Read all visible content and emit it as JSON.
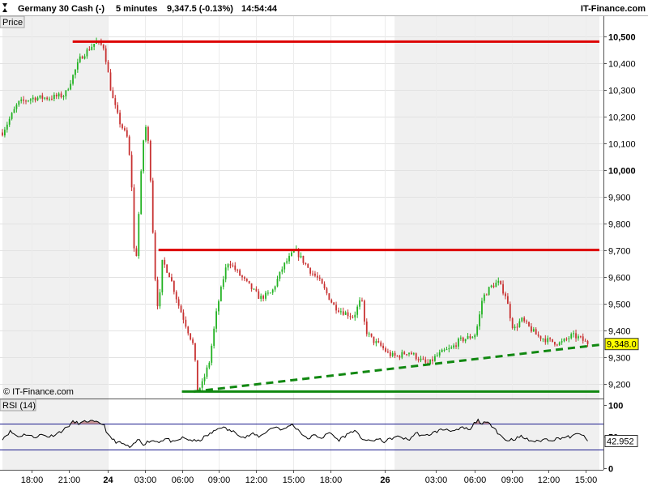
{
  "header": {
    "instrument": "Germany 30 Cash (-)",
    "interval": "5 minutes",
    "quote": "9,347.5 (-0.13%)",
    "time": "14:54:44",
    "brand": "IT-Finance.com"
  },
  "price_panel": {
    "label": "Price",
    "copyright": "© IT-Finance.com",
    "last_price_badge": "9,348.0"
  },
  "rsi_panel": {
    "label": "RSI (14)",
    "last_value_badge": "42.952"
  },
  "colors": {
    "up_candle": "#22b222",
    "down_candle": "#c83232",
    "resistance": "#dd0000",
    "support": "#118811",
    "rsi_line": "#000000",
    "rsi_band": "#1a1a8c",
    "rsi_overbought_fill": "#c89696",
    "session_shade": "#f0f0f0"
  },
  "chart_data": [
    {
      "type": "candlestick",
      "yticks": [
        "10,500",
        "10,400",
        "10,300",
        "10,200",
        "10,100",
        "10,000",
        "9,900",
        "9,800",
        "9,700",
        "9,600",
        "9,500",
        "9,400",
        "9,300",
        "9,200"
      ],
      "ytick_values": [
        10500,
        10400,
        10300,
        10200,
        10100,
        10000,
        9900,
        9800,
        9700,
        9600,
        9500,
        9400,
        9300,
        9200
      ],
      "ylim": [
        9150,
        10545
      ],
      "xlim": [
        0,
        153
      ],
      "xticks": [
        {
          "label": "18:00",
          "t": 7.5,
          "bold": false
        },
        {
          "label": "21:00",
          "t": 17,
          "bold": false
        },
        {
          "label": "24",
          "t": 27,
          "bold": true
        },
        {
          "label": "03:00",
          "t": 36.5,
          "bold": false
        },
        {
          "label": "06:00",
          "t": 46,
          "bold": false
        },
        {
          "label": "09:00",
          "t": 55.5,
          "bold": false
        },
        {
          "label": "12:00",
          "t": 65,
          "bold": false
        },
        {
          "label": "15:00",
          "t": 74.5,
          "bold": false
        },
        {
          "label": "18:00",
          "t": 84,
          "bold": false
        },
        {
          "label": "26",
          "t": 98,
          "bold": true
        },
        {
          "label": "03:00",
          "t": 111,
          "bold": false
        },
        {
          "label": "06:00",
          "t": 121,
          "bold": false
        },
        {
          "label": "09:00",
          "t": 130.5,
          "bold": false
        },
        {
          "label": "12:00",
          "t": 140,
          "bold": false
        },
        {
          "label": "15:00",
          "t": 149.5,
          "bold": false
        }
      ],
      "shaded_sessions": [
        [
          0,
          27
        ],
        [
          100.5,
          153
        ]
      ],
      "anchors": [
        [
          0,
          10140
        ],
        [
          4,
          10250
        ],
        [
          8,
          10270
        ],
        [
          12,
          10270
        ],
        [
          16,
          10280
        ],
        [
          20,
          10420
        ],
        [
          24,
          10480
        ],
        [
          26,
          10460
        ],
        [
          28,
          10280
        ],
        [
          30,
          10180
        ],
        [
          32,
          10120
        ],
        [
          33,
          9990
        ],
        [
          34,
          9600
        ],
        [
          35,
          9850
        ],
        [
          36,
          10100
        ],
        [
          37,
          10180
        ],
        [
          38,
          9960
        ],
        [
          39,
          9620
        ],
        [
          40,
          9460
        ],
        [
          41,
          9660
        ],
        [
          43,
          9600
        ],
        [
          45,
          9500
        ],
        [
          47,
          9420
        ],
        [
          49,
          9340
        ],
        [
          50,
          9180
        ],
        [
          51,
          9190
        ],
        [
          53,
          9280
        ],
        [
          55,
          9480
        ],
        [
          57,
          9620
        ],
        [
          58,
          9660
        ],
        [
          60,
          9620
        ],
        [
          63,
          9570
        ],
        [
          66,
          9520
        ],
        [
          69,
          9540
        ],
        [
          72,
          9640
        ],
        [
          75,
          9700
        ],
        [
          77,
          9660
        ],
        [
          79,
          9620
        ],
        [
          81,
          9590
        ],
        [
          83,
          9540
        ],
        [
          85,
          9490
        ],
        [
          87,
          9470
        ],
        [
          90,
          9450
        ],
        [
          92,
          9520
        ],
        [
          93,
          9400
        ],
        [
          95,
          9360
        ],
        [
          97,
          9340
        ],
        [
          99,
          9310
        ],
        [
          101,
          9300
        ],
        [
          104,
          9320
        ],
        [
          107,
          9290
        ],
        [
          109,
          9270
        ],
        [
          111,
          9300
        ],
        [
          113,
          9320
        ],
        [
          115,
          9330
        ],
        [
          117,
          9360
        ],
        [
          119,
          9370
        ],
        [
          121,
          9380
        ],
        [
          122,
          9430
        ],
        [
          123,
          9520
        ],
        [
          125,
          9560
        ],
        [
          127,
          9580
        ],
        [
          129,
          9530
        ],
        [
          130,
          9460
        ],
        [
          131,
          9400
        ],
        [
          133,
          9440
        ],
        [
          135,
          9410
        ],
        [
          137,
          9380
        ],
        [
          140,
          9360
        ],
        [
          143,
          9350
        ],
        [
          146,
          9380
        ],
        [
          148,
          9370
        ],
        [
          150,
          9348
        ]
      ],
      "last_price": 9348.0,
      "lines": [
        {
          "name": "upper-resistance",
          "kind": "horizontal",
          "value": 10480,
          "t_start": 18,
          "t_end": 153,
          "style": "solid",
          "color": "#dd0000"
        },
        {
          "name": "mid-resistance",
          "kind": "horizontal",
          "value": 9700,
          "t_start": 40,
          "t_end": 153,
          "style": "solid",
          "color": "#dd0000"
        },
        {
          "name": "support",
          "kind": "horizontal",
          "value": 9170,
          "t_start": 46,
          "t_end": 153,
          "style": "solid",
          "color": "#118811"
        },
        {
          "name": "trendline",
          "kind": "segment",
          "t_start": 49,
          "v_start": 9170,
          "t_end": 153,
          "v_end": 9345,
          "style": "dashed",
          "color": "#118811"
        }
      ]
    },
    {
      "type": "line",
      "series_title": "RSI (14)",
      "yticks": [
        "100",
        "50",
        "0"
      ],
      "ytick_values": [
        100,
        50,
        0
      ],
      "ylim": [
        0,
        100
      ],
      "bands": [
        70,
        30
      ],
      "last_value": 42.952,
      "anchors": [
        [
          0,
          47
        ],
        [
          2,
          58
        ],
        [
          4,
          50
        ],
        [
          6,
          54
        ],
        [
          8,
          49
        ],
        [
          10,
          53
        ],
        [
          12,
          50
        ],
        [
          14,
          55
        ],
        [
          16,
          62
        ],
        [
          18,
          73
        ],
        [
          20,
          71
        ],
        [
          22,
          75
        ],
        [
          24,
          72
        ],
        [
          26,
          70
        ],
        [
          27,
          52
        ],
        [
          29,
          42
        ],
        [
          31,
          38
        ],
        [
          32,
          35
        ],
        [
          33,
          32
        ],
        [
          34,
          40
        ],
        [
          35,
          46
        ],
        [
          36,
          38
        ],
        [
          38,
          44
        ],
        [
          40,
          42
        ],
        [
          42,
          47
        ],
        [
          44,
          40
        ],
        [
          46,
          48
        ],
        [
          48,
          45
        ],
        [
          50,
          42
        ],
        [
          52,
          50
        ],
        [
          54,
          57
        ],
        [
          56,
          66
        ],
        [
          58,
          60
        ],
        [
          60,
          56
        ],
        [
          62,
          48
        ],
        [
          64,
          54
        ],
        [
          66,
          50
        ],
        [
          68,
          60
        ],
        [
          70,
          66
        ],
        [
          72,
          60
        ],
        [
          74,
          70
        ],
        [
          76,
          60
        ],
        [
          78,
          46
        ],
        [
          80,
          52
        ],
        [
          82,
          48
        ],
        [
          84,
          57
        ],
        [
          86,
          44
        ],
        [
          88,
          52
        ],
        [
          90,
          60
        ],
        [
          92,
          48
        ],
        [
          94,
          42
        ],
        [
          96,
          46
        ],
        [
          98,
          42
        ],
        [
          100,
          48
        ],
        [
          102,
          50
        ],
        [
          104,
          44
        ],
        [
          106,
          56
        ],
        [
          108,
          50
        ],
        [
          110,
          55
        ],
        [
          112,
          60
        ],
        [
          114,
          62
        ],
        [
          116,
          58
        ],
        [
          118,
          64
        ],
        [
          120,
          60
        ],
        [
          121,
          72
        ],
        [
          122,
          76
        ],
        [
          123,
          70
        ],
        [
          124,
          72
        ],
        [
          126,
          66
        ],
        [
          127,
          56
        ],
        [
          129,
          44
        ],
        [
          131,
          46
        ],
        [
          133,
          50
        ],
        [
          135,
          44
        ],
        [
          137,
          42
        ],
        [
          139,
          46
        ],
        [
          141,
          45
        ],
        [
          143,
          48
        ],
        [
          146,
          50
        ],
        [
          148,
          56
        ],
        [
          150,
          43
        ]
      ]
    }
  ]
}
